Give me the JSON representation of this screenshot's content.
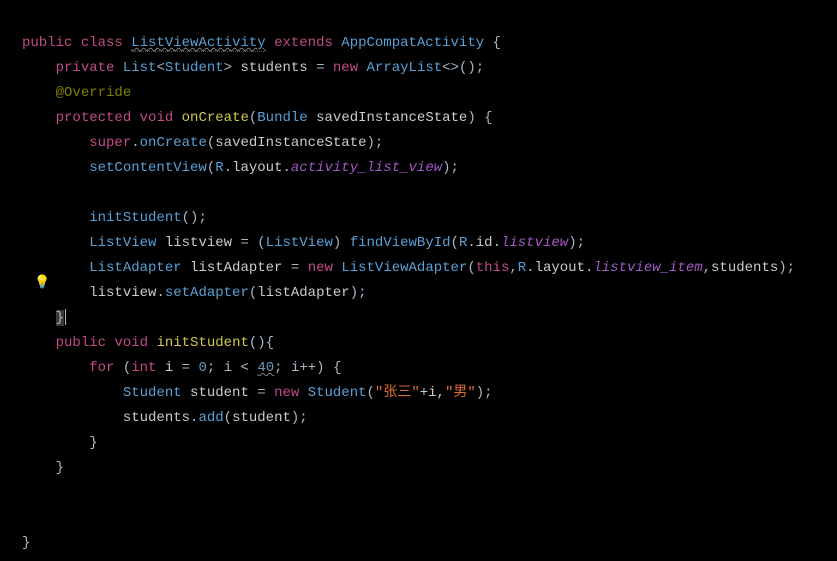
{
  "code": {
    "l1": {
      "kw_public": "public",
      "kw_class": "class",
      "classname": "ListViewActivity",
      "kw_extends": "extends",
      "superclass": "AppCompatActivity"
    },
    "l2": {
      "kw_private": "private",
      "type_list": "List",
      "type_student": "Student",
      "var": "students",
      "kw_new": "new",
      "type_arraylist": "ArrayList"
    },
    "l3": {
      "ann": "@Override"
    },
    "l4": {
      "kw_protected": "protected",
      "kw_void": "void",
      "method": "onCreate",
      "argtype": "Bundle",
      "argname": "savedInstanceState"
    },
    "l5": {
      "kw_super": "super",
      "method": "onCreate",
      "arg": "savedInstanceState"
    },
    "l6": {
      "method": "setContentView",
      "r": "R",
      "layout": "layout",
      "field": "activity_list_view"
    },
    "l7": {
      "method": "initStudent"
    },
    "l8": {
      "type": "ListView",
      "var": "listview",
      "cast": "ListView",
      "method": "findViewById",
      "r": "R",
      "id": "id",
      "field": "listview"
    },
    "l9": {
      "type": "ListAdapter",
      "var": "listAdapter",
      "kw_new": "new",
      "ctor": "ListViewAdapter",
      "kw_this": "this",
      "r": "R",
      "layout": "layout",
      "field": "listview_item",
      "arg3": "students"
    },
    "l10": {
      "var": "listview",
      "method": "setAdapter",
      "arg": "listAdapter"
    },
    "l12": {
      "kw_public": "public",
      "kw_void": "void",
      "method": "initStudent"
    },
    "l13": {
      "kw_for": "for",
      "kw_int": "int",
      "var": "i",
      "init": "0",
      "cond": "40"
    },
    "l14": {
      "type": "Student",
      "var": "student",
      "kw_new": "new",
      "ctor": "Student",
      "str1": "\"张三\"",
      "plus": "+i,",
      "str2": "\"男\""
    },
    "l15": {
      "var": "students",
      "method": "add",
      "arg": "student"
    }
  }
}
